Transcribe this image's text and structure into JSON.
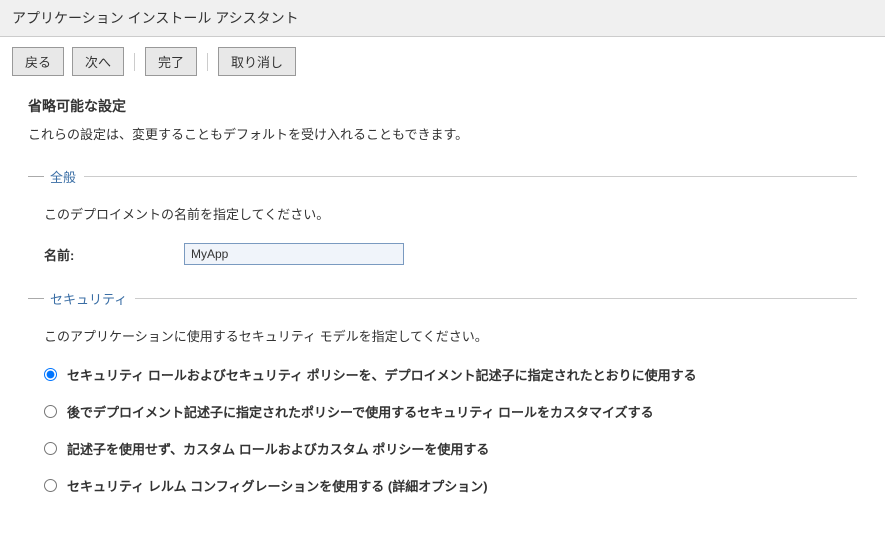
{
  "title": "アプリケーション インストール アシスタント",
  "buttons": {
    "back": "戻る",
    "next": "次へ",
    "finish": "完了",
    "cancel": "取り消し"
  },
  "section": {
    "title": "省略可能な設定",
    "desc": "これらの設定は、変更することもデフォルトを受け入れることもできます。"
  },
  "general": {
    "legend": "全般",
    "desc": "このデプロイメントの名前を指定してください。",
    "name_label": "名前:",
    "name_value": "MyApp"
  },
  "security": {
    "legend": "セキュリティ",
    "desc": "このアプリケーションに使用するセキュリティ モデルを指定してください。",
    "options": [
      "セキュリティ ロールおよびセキュリティ ポリシーを、デプロイメント記述子に指定されたとおりに使用する",
      "後でデプロイメント記述子に指定されたポリシーで使用するセキュリティ ロールをカスタマイズする",
      "記述子を使用せず、カスタム ロールおよびカスタム ポリシーを使用する",
      "セキュリティ レルム コンフィグレーションを使用する (詳細オプション)"
    ]
  }
}
